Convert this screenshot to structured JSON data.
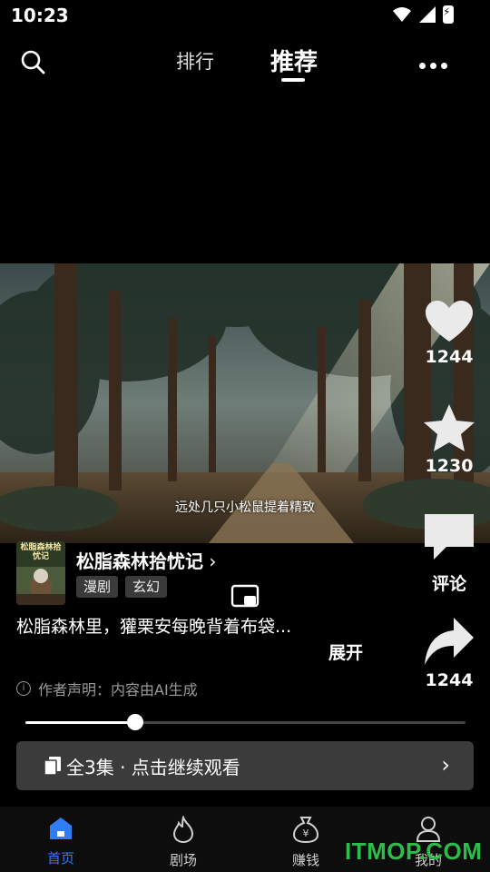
{
  "status": {
    "time": "10:23"
  },
  "topnav": {
    "tab_rank": "排行",
    "tab_recommend": "推荐",
    "active_tab": "推荐"
  },
  "video": {
    "subtitle": "远处几只小松鼠提着精致"
  },
  "actions": {
    "likes": "1244",
    "favorites": "1230",
    "comment_label": "评论",
    "shares": "1244"
  },
  "drama": {
    "title": "松脂森林拾忧记",
    "tags": [
      "漫剧",
      "玄幻"
    ],
    "cover_text": "松脂森林拾忧记",
    "description": "松脂森林里，獾栗安每晚背着布袋...",
    "expand_label": "展开",
    "notice": "作者声明：内容由AI生成"
  },
  "progress": {
    "fraction": 0.25
  },
  "episodes": {
    "label": "全3集 · 点击继续观看"
  },
  "bottom_nav": [
    {
      "label": "首页",
      "icon": "home-icon",
      "active": true
    },
    {
      "label": "剧场",
      "icon": "flame-icon",
      "active": false
    },
    {
      "label": "赚钱",
      "icon": "money-bag-icon",
      "active": false
    },
    {
      "label": "我的",
      "icon": "profile-icon",
      "active": false
    }
  ],
  "watermark": "ITMOP.COM",
  "colors": {
    "accent": "#2f7cf6",
    "background": "#000000",
    "watermark": "#2dbd4a"
  }
}
